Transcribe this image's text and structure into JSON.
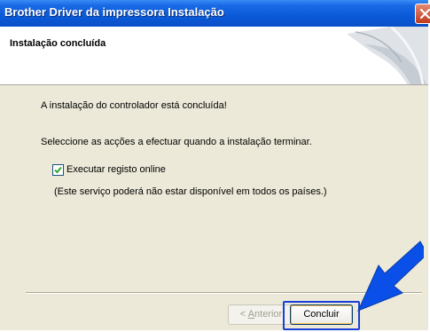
{
  "window": {
    "title": "Brother Driver da impressora Instalação",
    "close_icon": "close-icon"
  },
  "header": {
    "title": "Instalação concluída"
  },
  "body": {
    "message": "A instalação do controlador está concluída!",
    "instruction": "Seleccione as acções a efectuar quando a instalação terminar.",
    "checkbox_label": "Executar registo online",
    "checkbox_checked": true,
    "note": "(Este serviço poderá não estar disponível em todos os países.)"
  },
  "footer": {
    "back_prefix": "< ",
    "back_underlined": "A",
    "back_rest": "nterior",
    "finish_label": "Concluir"
  },
  "colors": {
    "titlebar": "#0A5AD8",
    "panel": "#ECE9D8",
    "pointer_arrow": "#0A50E8"
  }
}
